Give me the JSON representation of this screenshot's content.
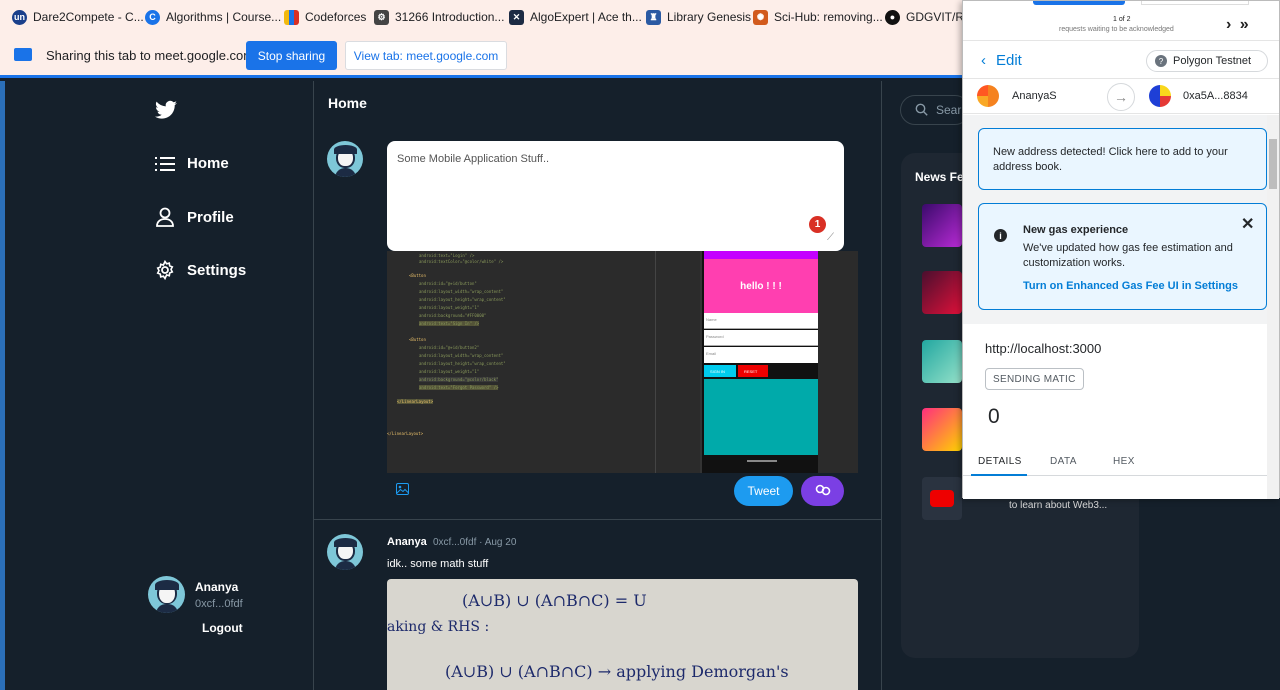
{
  "bookmarks": [
    {
      "label": "Dare2Compete - C...",
      "icon": "un",
      "color": "#1a3f8b"
    },
    {
      "label": "Algorithms | Course...",
      "icon": "C",
      "color": "#1a73e8"
    },
    {
      "label": "Codeforces",
      "icon": "▮",
      "color": "#f2b90f"
    },
    {
      "label": "31266 Introduction...",
      "icon": "⚙",
      "color": "#444"
    },
    {
      "label": "AlgoExpert | Ace th...",
      "icon": "✕",
      "color": "#1c2b44"
    },
    {
      "label": "Library Genesis",
      "icon": "♜",
      "color": "#2b5aa3"
    },
    {
      "label": "Sci-Hub: removing...",
      "icon": "✺",
      "color": "#d25a1c"
    },
    {
      "label": "GDGVIT/Res",
      "icon": "●",
      "color": "#111"
    }
  ],
  "share": {
    "text": "Sharing this tab to meet.google.com",
    "stop_label": "Stop sharing",
    "view_label": "View tab: meet.google.com"
  },
  "sidebar": {
    "items": [
      {
        "label": "Home",
        "icon": "menu-icon"
      },
      {
        "label": "Profile",
        "icon": "person-icon"
      },
      {
        "label": "Settings",
        "icon": "gear-icon"
      }
    ],
    "user": {
      "name": "Ananya",
      "address": "0xcf...0fdf"
    },
    "logout_label": "Logout"
  },
  "main": {
    "title": "Home",
    "composer_text": "Some Mobile Application Stuff..",
    "badge": "1",
    "tweet_label": "Tweet",
    "phone_text": "hello ! ! !",
    "phone_fields": [
      "Name",
      "Password",
      "Email"
    ],
    "phone_buttons": [
      "SIGN IN",
      "RESET"
    ]
  },
  "post": {
    "name": "Ananya",
    "meta": "0xcf...0fdf · Aug 20",
    "text": "idk.. some math stuff",
    "handwriting": [
      "(A∪B) ∪ (A∩B∩C) = U",
      "aking  &  RHS :",
      "(A∪B) ∪ (A∩B∩C)  → applying  Demorgan's"
    ]
  },
  "right": {
    "search_placeholder": "Sear",
    "news_title": "News Fe",
    "news_snippet": "to learn about Web3..."
  },
  "metamask": {
    "queue_count": "1 of 2",
    "queue_text": "requests waiting to be acknowledged",
    "edit_label": "Edit",
    "network": "Polygon Testnet",
    "from": "AnanyaS",
    "to": "0xa5A...8834",
    "notice": "New address detected! Click here to add to your address book.",
    "gas_title": "New gas experience",
    "gas_desc": "We've updated how gas fee estimation and customization works.",
    "gas_link": "Turn on Enhanced Gas Fee UI in Settings",
    "site": "http://localhost:3000",
    "method": "SENDING MATIC",
    "amount": "0",
    "tabs": [
      "DETAILS",
      "DATA",
      "HEX"
    ]
  },
  "colors": {
    "twitter_blue": "#1d9bf0",
    "metamask_blue": "#037dd6",
    "chrome_blue": "#1a73e8",
    "bg": "#15202b"
  }
}
